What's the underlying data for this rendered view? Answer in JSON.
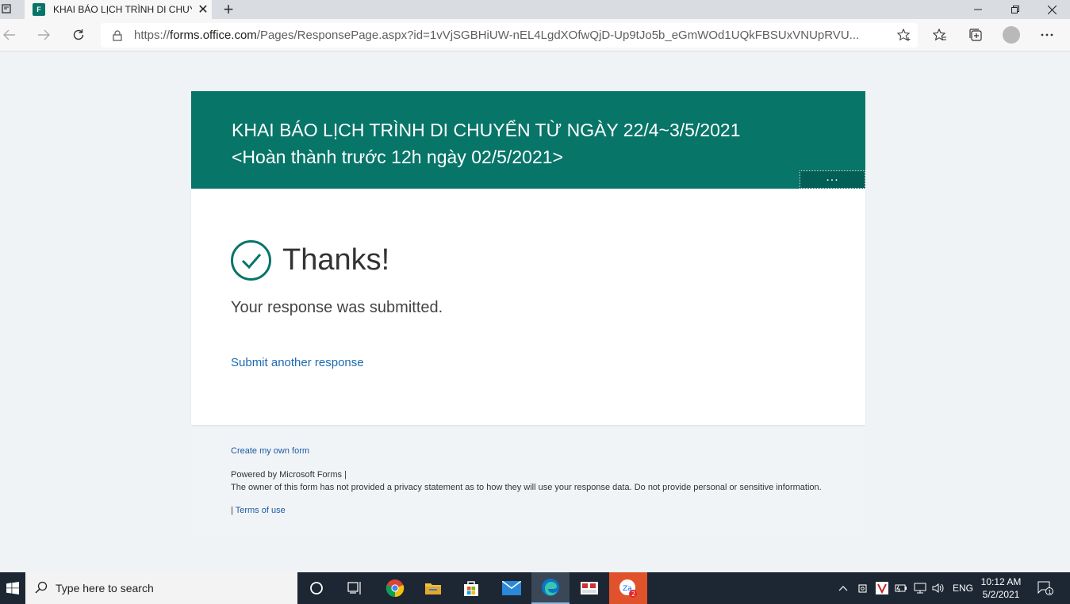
{
  "browser": {
    "tab_title": "KHAI BÁO LỊCH TRÌNH DI CHUYỂ",
    "favicon_text": "F",
    "url_prefix": "https://",
    "url_host": "forms.office.com",
    "url_path": "/Pages/ResponsePage.aspx?id=1vVjSGBHiUW-nEL4LgdXOfwQjD-Up9tJo5b_eGmWOd1UQkFBSUxVNUpRVU..."
  },
  "form": {
    "title_line1": "KHAI BÁO LỊCH TRÌNH DI CHUYỂN TỪ NGÀY 22/4~3/5/2021",
    "title_line2": "<Hoàn thành trước 12h ngày 02/5/2021>",
    "more_label": "...",
    "thanks_heading": "Thanks!",
    "submitted_text": "Your response was submitted.",
    "submit_another": "Submit another response"
  },
  "footer": {
    "create_link": "Create my own form",
    "powered_by": "Powered by Microsoft Forms |",
    "privacy_text": "The owner of this form has not provided a privacy statement as to how they will use your response data. Do not provide personal or sensitive information.",
    "terms_prefix": "| ",
    "terms_link": "Terms of use"
  },
  "taskbar": {
    "search_placeholder": "Type here to search",
    "language": "ENG",
    "time": "10:12 AM",
    "date": "5/2/2021",
    "zalo_badge": "2",
    "notification_count": "1"
  },
  "colors": {
    "brand": "#077568",
    "link": "#1b6bb0"
  }
}
